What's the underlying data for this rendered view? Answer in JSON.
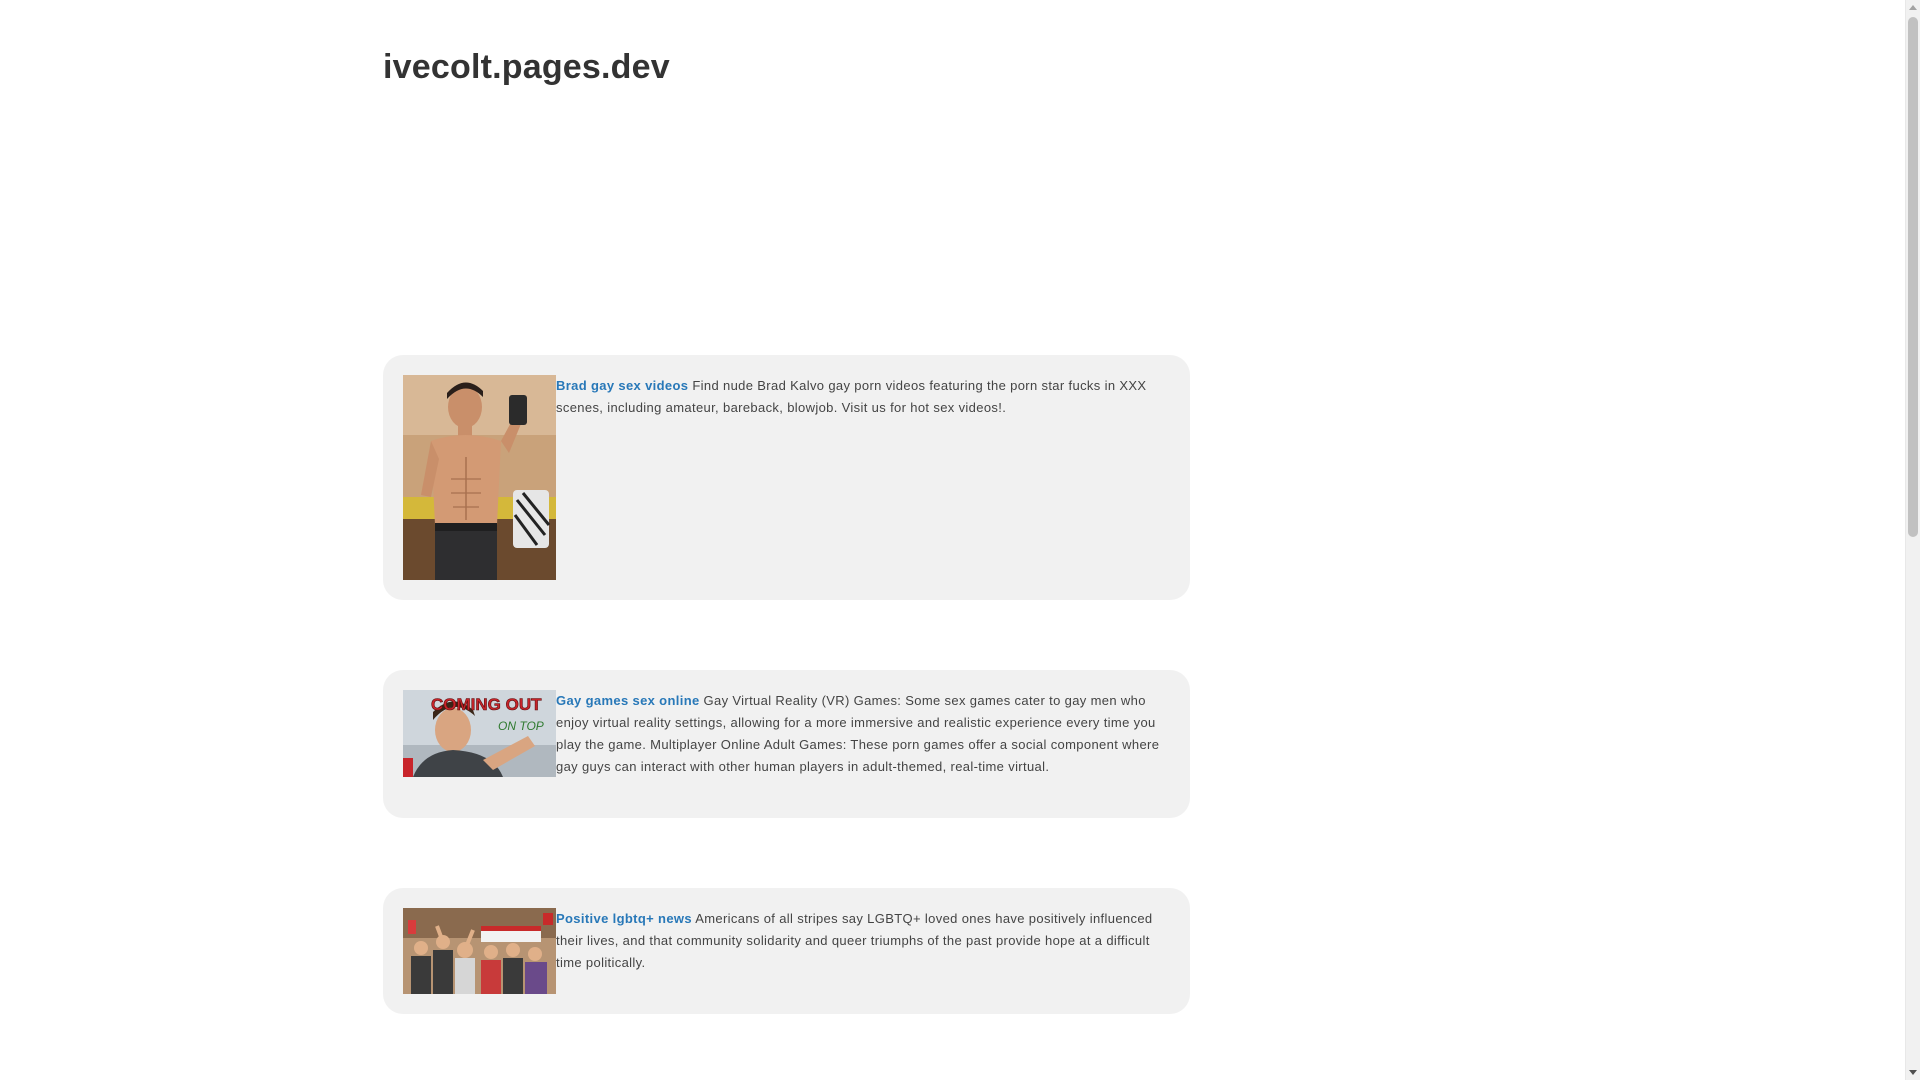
{
  "site": {
    "title": "ivecolt.pages.dev"
  },
  "articles": [
    {
      "link_text": "Brad gay sex videos",
      "description": " Find nude Brad Kalvo gay porn videos featuring the porn star fucks in XXX scenes, including amateur, bareback, blowjob. Visit us for hot sex videos!.",
      "image_alt": "shirtless man mirror selfie photo"
    },
    {
      "link_text": "Gay games sex online",
      "description": " Gay Virtual Reality (VR) Games: Some sex games cater to gay men who enjoy virtual reality settings, allowing for a more immersive and realistic experience every time you play the game. Multiplayer Online Adult Games: These porn games offer a social component where gay guys can interact with other human players in adult-themed, real-time virtual.",
      "image_text_top": "COMING OUT",
      "image_text_sub": "ON TOP"
    },
    {
      "link_text": "Positive lgbtq+ news",
      "description": " Americans of all stripes say LGBTQ+ loved ones have positively influenced their lives, and that community solidarity and queer triumphs of the past provide hope at a difficult time politically.",
      "image_alt": "crowd at pride march photo"
    }
  ],
  "colors": {
    "link": "#2878b8",
    "card_bg": "#f1f1f1",
    "title": "#333333",
    "body_text": "#444444"
  }
}
